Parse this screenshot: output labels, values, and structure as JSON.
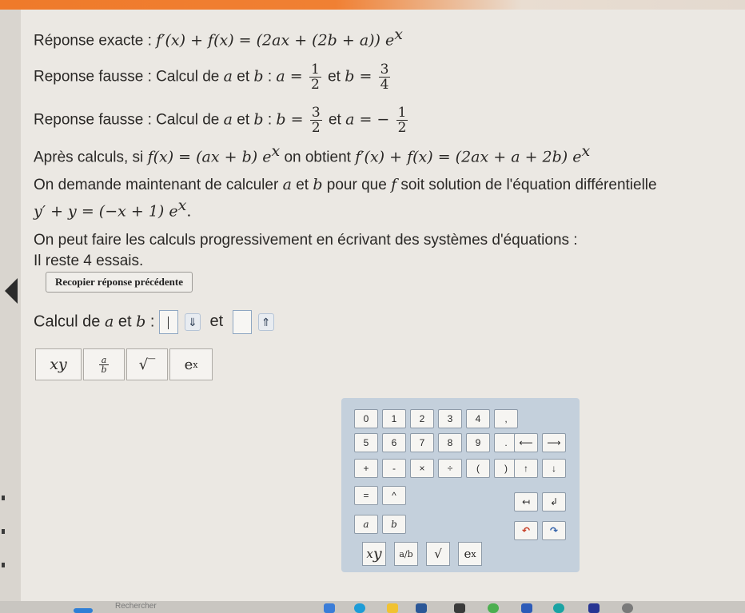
{
  "lines": {
    "l1_prefix": "Réponse exacte :",
    "l2_prefix": "Reponse fausse : Calcul de",
    "l2_and": "et",
    "l2_colon": ":",
    "l2_mid": "et",
    "l3_prefix": "Reponse fausse : Calcul de",
    "l3_and": "et",
    "l3_colon": ":",
    "l3_mid": "et",
    "l4_prefix": "Après calculs, si",
    "l4_mid": "on obtient",
    "l5_text_a": "On demande maintenant de calculer",
    "l5_and": "et",
    "l5_text_b": "pour que",
    "l5_text_c": "soit solution de l'équation différentielle",
    "l7_text": "On peut faire les calculs progressivement en écrivant des systèmes d'équations :",
    "l8_text": "Il reste 4 essais."
  },
  "math": {
    "a": "a",
    "b": "b",
    "f": "f",
    "frac_1": "1",
    "frac_2": "2",
    "frac_3": "3",
    "frac_4": "4",
    "l1_formula_lhs": "f′(x) + f(x) = (2ax + (2b + a)) e",
    "l1_exp": "x",
    "l2_a_eq": "a =",
    "l2_b_eq": "b =",
    "l3_b_eq": "b =",
    "l3_a_eq": "a = −",
    "l4_f": "f(x) = (ax + b) e",
    "l4_exp": "x",
    "l4_res": "f′(x) + f(x) = (2ax + a + 2b) e",
    "l4_res_exp": "x",
    "l6_eq": "y′ + y = (−x + 1) e",
    "l6_exp": "x",
    "l6_dot": "."
  },
  "controls": {
    "copy_previous": "Recopier réponse précédente",
    "calc_prefix": "Calcul de",
    "calc_and": "et",
    "calc_colon": ":",
    "calc_mid": "et",
    "down_arrow": "⇓",
    "up_arrow": "⇑"
  },
  "tools": {
    "power": "x",
    "power_exp": "y",
    "frac_num": "a",
    "frac_den": "b",
    "sqrt": "√‾",
    "exp": "e",
    "exp_sup": "x"
  },
  "keypad": {
    "row1": [
      "0",
      "1",
      "2",
      "3",
      "4",
      ","
    ],
    "row2": [
      "5",
      "6",
      "7",
      "8",
      "9",
      "."
    ],
    "row2_arrows": [
      "⟵",
      "⟶"
    ],
    "row3": [
      "+",
      "-",
      "×",
      "÷",
      "(",
      ")"
    ],
    "row3_arrows": [
      "↑",
      "↓"
    ],
    "row4": [
      "=",
      "^"
    ],
    "row4_arrows": [
      "↤",
      "↲"
    ],
    "row5": [
      "a",
      "b"
    ],
    "row5_icons": [
      "undo-icon",
      "redo-icon"
    ],
    "bottom_tools": [
      "x",
      "a/b",
      "√",
      "e"
    ],
    "bottom_tools_sup": [
      "y",
      "x"
    ]
  },
  "taskbar": {
    "search_label": "Rechercher"
  },
  "colors": {
    "accent_orange": "#ef7a2a",
    "keypad_bg": "#c4d0dc"
  }
}
